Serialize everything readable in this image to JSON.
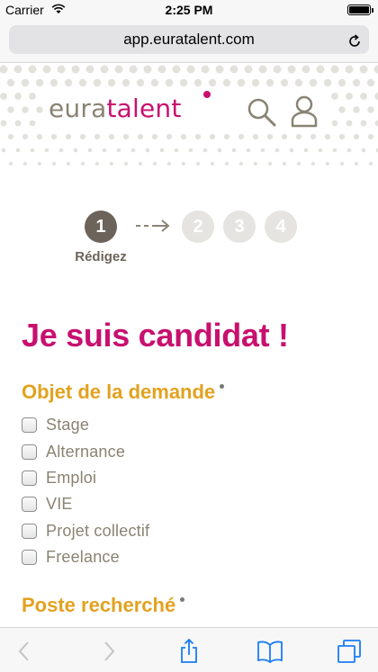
{
  "status_bar": {
    "carrier": "Carrier",
    "time": "2:25 PM",
    "battery_level": 1.0
  },
  "browser": {
    "url": "app.euratalent.com",
    "reload_icon": "reload-icon"
  },
  "header": {
    "logo_part1": "eura",
    "logo_part2": "talent",
    "search_icon": "search-icon",
    "user_icon": "user-icon"
  },
  "steps": {
    "items": [
      "1",
      "2",
      "3",
      "4"
    ],
    "current": 1,
    "current_label": "Rédigez"
  },
  "form": {
    "title": "Je suis candidat !",
    "section1_title": "Objet de la demande",
    "options": [
      "Stage",
      "Alternance",
      "Emploi",
      "VIE",
      "Projet collectif",
      "Freelance"
    ],
    "section2_title": "Poste recherché"
  },
  "toolbar": {
    "icons": [
      "back-icon",
      "forward-icon",
      "share-icon",
      "bookmarks-icon",
      "tabs-icon"
    ]
  },
  "colors": {
    "brand_pink": "#c8106f",
    "section_orange": "#e2a21f",
    "taupe": "#8a8373",
    "ios_blue": "#1a7cf5"
  }
}
